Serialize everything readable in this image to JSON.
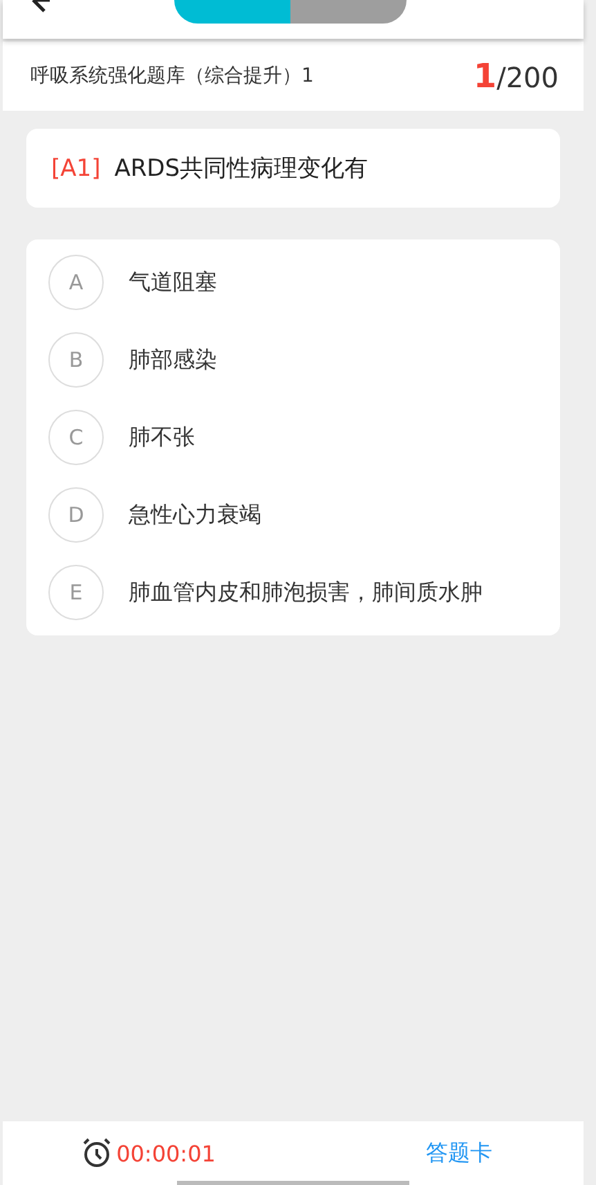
{
  "header": {
    "mode_toggle": [
      {
        "selected": true
      },
      {
        "selected": false
      }
    ]
  },
  "title_bar": {
    "title": "呼吸系统强化题库（综合提升）1",
    "current": "1",
    "total": "/200"
  },
  "question": {
    "type": "[A1]",
    "text": "ARDS共同性病理变化有"
  },
  "options": [
    {
      "letter": "A",
      "text": "气道阻塞",
      "selected": false
    },
    {
      "letter": "B",
      "text": "肺部感染",
      "selected": false
    },
    {
      "letter": "C",
      "text": "肺不张",
      "selected": false
    },
    {
      "letter": "D",
      "text": "急性心力衰竭",
      "selected": false
    },
    {
      "letter": "E",
      "text": "肺血管内皮和肺泡损害，肺间质水肿",
      "selected": false
    }
  ],
  "footer": {
    "timer": "00:00:01",
    "answer_card": "答题卡"
  }
}
